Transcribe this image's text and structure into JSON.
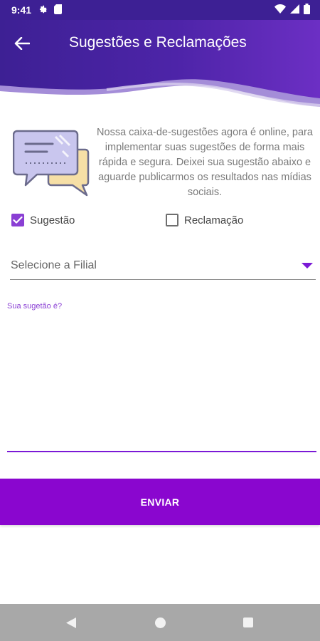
{
  "status_bar": {
    "time": "9:41",
    "icons": [
      "settings-icon",
      "sim-card-icon",
      "wifi-icon",
      "signal-icon",
      "battery-icon"
    ]
  },
  "header": {
    "title": "Sugestões e Reclamações",
    "back_icon": "arrow-left-icon",
    "colors": {
      "primary": "#3d2094",
      "accent": "#8a06cf"
    }
  },
  "intro": {
    "illustration": "chat-bubbles-icon",
    "text": "Nossa caixa-de-sugestões agora é online, para implementar suas sugestões de forma mais rápida e segura. Deixei sua sugestão abaixo e aguarde publicarmos os resultados nas mídias sociais."
  },
  "type_options": [
    {
      "label": "Sugestão",
      "checked": true
    },
    {
      "label": "Reclamação",
      "checked": false
    }
  ],
  "branch_select": {
    "value": "Selecione a Filial",
    "icon": "dropdown-arrow-icon"
  },
  "message_field": {
    "label": "Sua sugetão é?",
    "value": ""
  },
  "submit": {
    "label": "ENVIAR"
  },
  "nav_bar": {
    "buttons": [
      "back-triangle-icon",
      "home-circle-icon",
      "recents-square-icon"
    ]
  }
}
